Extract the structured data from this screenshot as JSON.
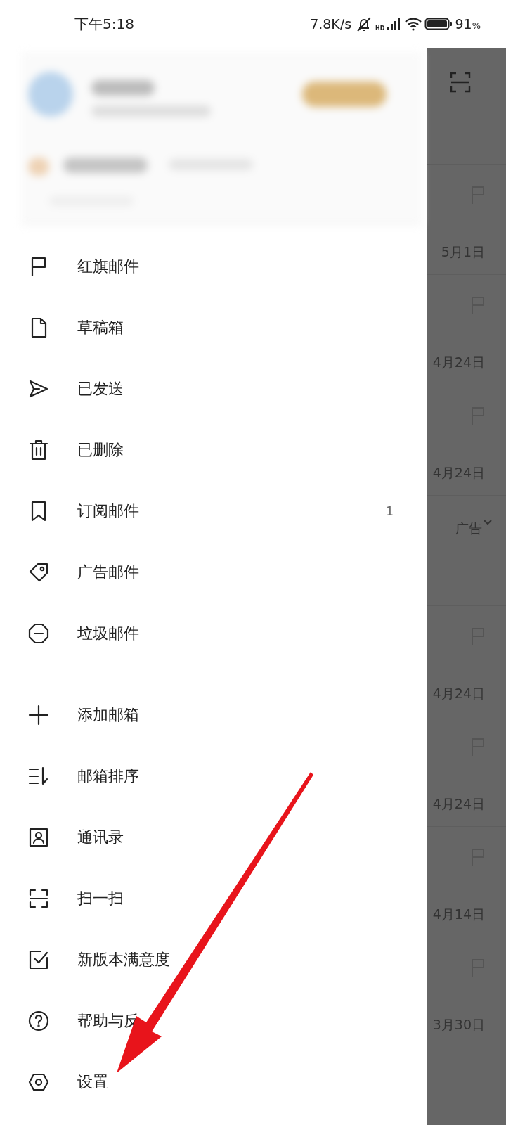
{
  "status_bar": {
    "time": "下午5:18",
    "net_speed": "7.8K/s",
    "battery": "91",
    "battery_unit": "%",
    "signal_label": "HD"
  },
  "menu_sections": [
    {
      "items": [
        {
          "kind": "flag",
          "label": "红旗邮件"
        },
        {
          "kind": "draft",
          "label": "草稿箱"
        },
        {
          "kind": "sent",
          "label": "已发送"
        },
        {
          "kind": "trash",
          "label": "已删除"
        },
        {
          "kind": "bookmark",
          "label": "订阅邮件",
          "count": "1"
        },
        {
          "kind": "tag",
          "label": "广告邮件"
        },
        {
          "kind": "spam",
          "label": "垃圾邮件"
        }
      ]
    },
    {
      "items": [
        {
          "kind": "add",
          "label": "添加邮箱"
        },
        {
          "kind": "sort",
          "label": "邮箱排序"
        },
        {
          "kind": "contacts",
          "label": "通讯录"
        },
        {
          "kind": "scan",
          "label": "扫一扫"
        },
        {
          "kind": "survey",
          "label": "新版本满意度"
        },
        {
          "kind": "help",
          "label": "帮助与反"
        },
        {
          "kind": "settings",
          "label": "设置"
        }
      ]
    }
  ],
  "background_list": [
    {
      "kind": "mail",
      "date": "5月1日"
    },
    {
      "kind": "mail",
      "date": "4月24日"
    },
    {
      "kind": "mail",
      "date": "4月24日"
    },
    {
      "kind": "ad",
      "label": "广告"
    },
    {
      "kind": "mail",
      "date": "4月24日"
    },
    {
      "kind": "mail",
      "date": "4月24日"
    },
    {
      "kind": "mail",
      "date": "4月14日"
    },
    {
      "kind": "mail",
      "date": "3月30日"
    }
  ]
}
